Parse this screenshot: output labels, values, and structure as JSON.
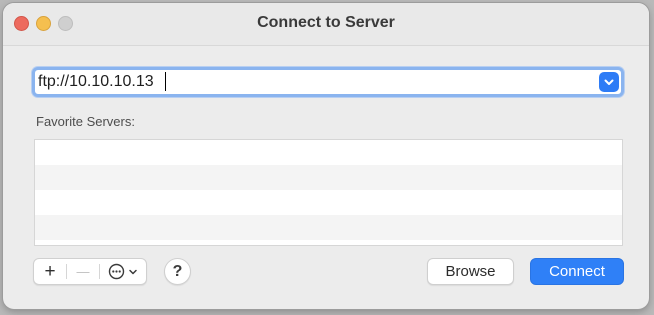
{
  "window": {
    "title": "Connect to Server"
  },
  "traffic_lights": {
    "close_color": "#ed6a5e",
    "minimize_color": "#f5bf4f",
    "zoom_color": "#cfcfcf"
  },
  "server_address": {
    "value": "ftp://10.10.10.13",
    "dropdown_icon": "chevron-down-icon"
  },
  "favorites": {
    "label": "Favorite Servers:",
    "items": []
  },
  "toolbar": {
    "add_symbol": "+",
    "remove_symbol": "—",
    "action_menu_icon": "ellipsis-circle-icon",
    "help_label": "?"
  },
  "buttons": {
    "browse_label": "Browse",
    "connect_label": "Connect"
  },
  "colors": {
    "accent": "#2f80f7"
  }
}
